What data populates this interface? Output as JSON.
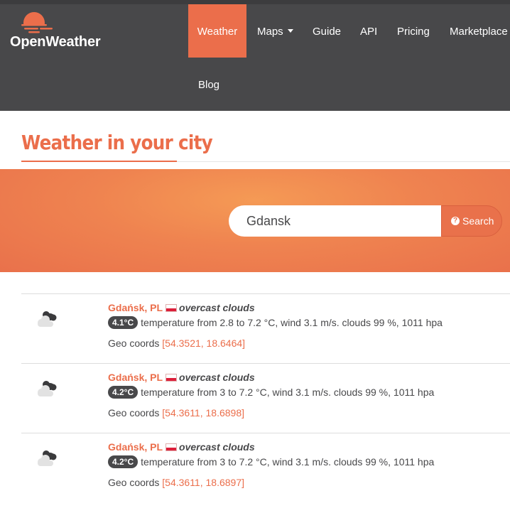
{
  "brand": {
    "name": "OpenWeather"
  },
  "nav": {
    "weather": "Weather",
    "maps": "Maps",
    "guide": "Guide",
    "api": "API",
    "pricing": "Pricing",
    "marketplace": "Marketplace",
    "blog": "Blog"
  },
  "page": {
    "title": "Weather in your city"
  },
  "search": {
    "value": "Gdansk",
    "button_label": "Search",
    "button_icon": "question-circle-icon"
  },
  "results": [
    {
      "city": "Gdańsk, PL",
      "country_flag": "PL",
      "description": "overcast clouds",
      "temp_badge": "4.1°C",
      "details": "temperature from 2.8 to 7.2 °C, wind 3.1 m/s. clouds 99 %, 1011 hpa",
      "geo_label": "Geo coords",
      "geo_coords": "[54.3521, 18.6464]",
      "icon": "overcast-clouds-icon"
    },
    {
      "city": "Gdańsk, PL",
      "country_flag": "PL",
      "description": "overcast clouds",
      "temp_badge": "4.2°C",
      "details": "temperature from 3 to 7.2 °C, wind 3.1 m/s. clouds 99 %, 1011 hpa",
      "geo_label": "Geo coords",
      "geo_coords": "[54.3611, 18.6898]",
      "icon": "overcast-clouds-icon"
    },
    {
      "city": "Gdańsk, PL",
      "country_flag": "PL",
      "description": "overcast clouds",
      "temp_badge": "4.2°C",
      "details": "temperature from 3 to 7.2 °C, wind 3.1 m/s. clouds 99 %, 1011 hpa",
      "geo_label": "Geo coords",
      "geo_coords": "[54.3611, 18.6897]",
      "icon": "overcast-clouds-icon"
    }
  ],
  "colors": {
    "accent": "#eb6e4b",
    "header_bg": "#48484a",
    "text": "#48484a",
    "flag_red": "#dc1f3a"
  }
}
